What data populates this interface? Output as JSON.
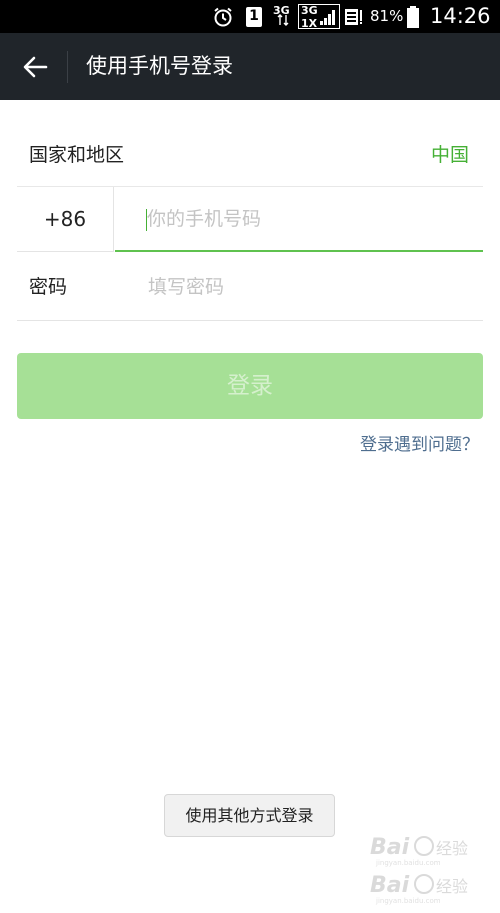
{
  "status_bar": {
    "sim_slot": "1",
    "network_top": "3G",
    "network_box_top": "3G",
    "network_box_bottom": "1X",
    "battery_percent": "81%",
    "time": "14:26"
  },
  "app_bar": {
    "title": "使用手机号登录",
    "back_icon": "arrow-left-icon"
  },
  "form": {
    "country_label": "国家和地区",
    "country_value": "中国",
    "phone_code": "+86",
    "phone_placeholder": "你的手机号码",
    "phone_value": "",
    "password_label": "密码",
    "password_placeholder": "填写密码",
    "password_value": ""
  },
  "actions": {
    "login_label": "登录",
    "help_link": "登录遇到问题？",
    "alt_login_label": "使用其他方式登录"
  },
  "colors": {
    "app_bar": "#20252a",
    "accent_green": "#45b035",
    "login_button_disabled": "#a6e096",
    "help_link": "#4f6e8f"
  }
}
